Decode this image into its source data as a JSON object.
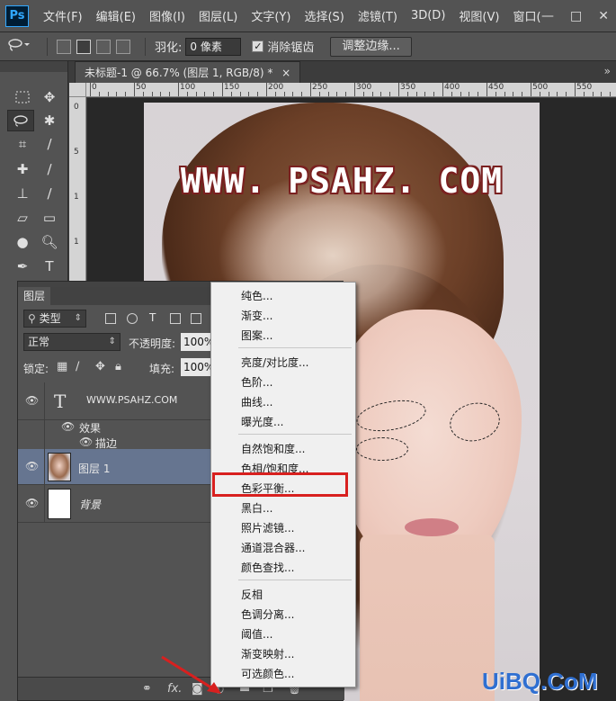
{
  "menubar": {
    "logo": "Ps",
    "items": [
      "文件(F)",
      "编辑(E)",
      "图像(I)",
      "图层(L)",
      "文字(Y)",
      "选择(S)",
      "滤镜(T)",
      "3D(D)",
      "视图(V)",
      "窗口("
    ],
    "controls": [
      "—",
      "□",
      "✕"
    ]
  },
  "options": {
    "feather_label": "羽化:",
    "feather_value": "0 像素",
    "antialias_label": "消除锯齿",
    "antialias_checked": true,
    "refine_button": "调整边缘..."
  },
  "document": {
    "tab_title": "未标题-1 @ 66.7% (图层 1, RGB/8) *",
    "tab_close": "×",
    "ruler_top": [
      "0",
      "50",
      "100",
      "150",
      "200",
      "250",
      "300",
      "350",
      "400",
      "450",
      "500",
      "550"
    ],
    "ruler_left": [
      "0",
      "5",
      "1",
      "1",
      "2",
      "2",
      "3",
      "3"
    ],
    "watermark_text": "WWW. PSAHZ. COM"
  },
  "layers": {
    "tab_label": "图层",
    "filter_type": "类型",
    "blend_mode": "正常",
    "opacity_label": "不透明度:",
    "opacity_value": "100%",
    "lock_label": "锁定:",
    "fill_label": "填充:",
    "fill_value": "100%",
    "items": [
      {
        "name": "WWW.PSAHZ.COM",
        "kind": "text"
      },
      {
        "name": "效果",
        "kind": "effects"
      },
      {
        "name": "描边",
        "kind": "effect"
      },
      {
        "name": "图层 1",
        "kind": "pixel",
        "selected": true
      },
      {
        "name": "背景",
        "kind": "background"
      }
    ],
    "bottom_icons": [
      "link-icon",
      "fx-icon",
      "mask-icon",
      "adjustment-icon",
      "group-icon",
      "new-layer-icon",
      "trash-icon"
    ],
    "fx_label": "fx."
  },
  "adjustment_menu": {
    "groups": [
      [
        "纯色...",
        "渐变...",
        "图案..."
      ],
      [
        "亮度/对比度...",
        "色阶...",
        "曲线...",
        "曝光度..."
      ],
      [
        "自然饱和度...",
        "色相/饱和度...",
        "色彩平衡...",
        "黑白...",
        "照片滤镜...",
        "通道混合器...",
        "颜色查找..."
      ],
      [
        "反相",
        "色调分离...",
        "阈值...",
        "渐变映射...",
        "可选颜色..."
      ]
    ],
    "highlighted": "色彩平衡..."
  },
  "site_watermark": "UiBQ.CoM",
  "colors": {
    "highlight_box": "#d8201f",
    "arrow": "#d8201f",
    "watermark_blue": "#2f6fd1"
  }
}
